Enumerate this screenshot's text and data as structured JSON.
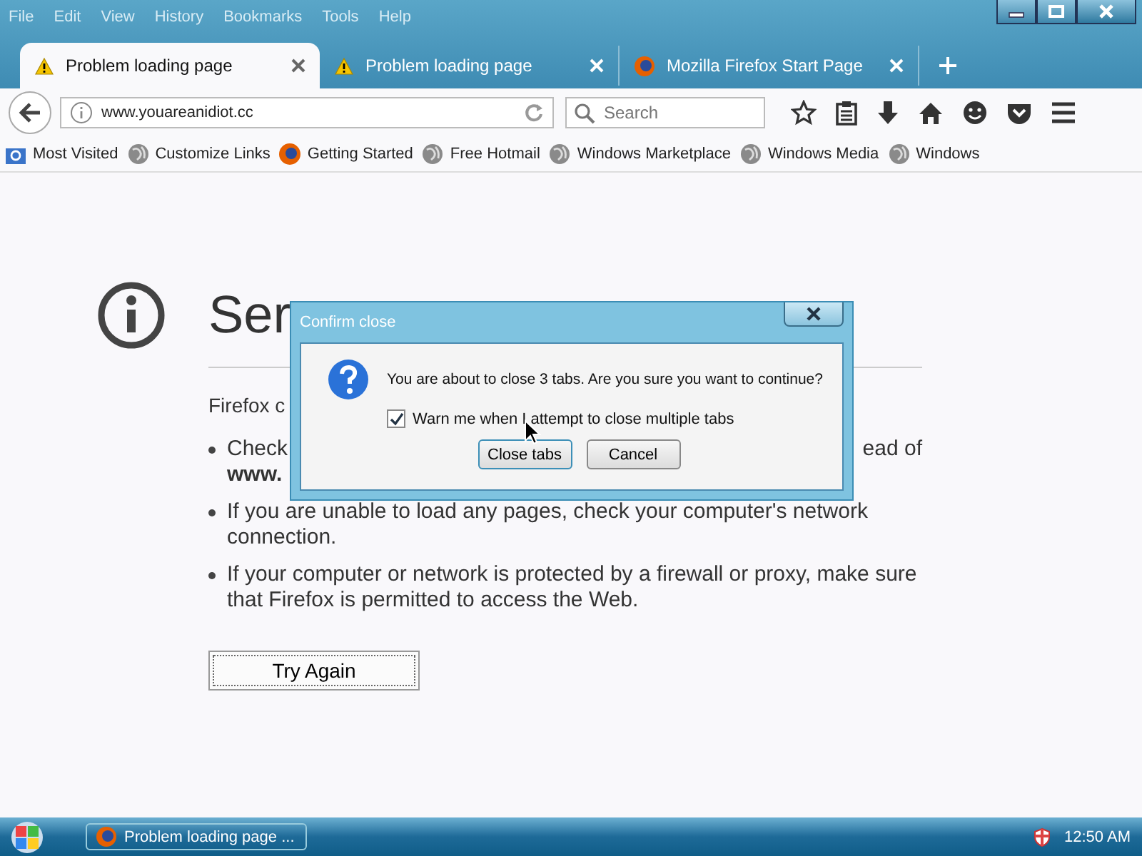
{
  "menu": [
    "File",
    "Edit",
    "View",
    "History",
    "Bookmarks",
    "Tools",
    "Help"
  ],
  "tabs": [
    {
      "title": "Problem loading page",
      "selected": true
    },
    {
      "title": "Problem loading page",
      "selected": false
    },
    {
      "title": "Mozilla Firefox Start Page",
      "selected": false
    }
  ],
  "address": {
    "value": "www.youareanidiot.cc"
  },
  "search": {
    "placeholder": "Search"
  },
  "bookmarks": [
    "Most Visited",
    "Customize Links",
    "Getting Started",
    "Free Hotmail",
    "Windows Marketplace",
    "Windows Media",
    "Windows"
  ],
  "error_page": {
    "heading": "Ser",
    "intro": "Firefox c",
    "bullets": [
      {
        "left": "Check",
        "right": "ead of",
        "line2": "www."
      },
      {
        "left": "If you are unable to load any pages, check your computer's network connection."
      },
      {
        "left": "If your computer or network is protected by a firewall or proxy, make sure that Firefox is permitted to access the Web."
      }
    ],
    "button": "Try Again"
  },
  "dialog": {
    "title": "Confirm close",
    "message": "You are about to close 3 tabs. Are you sure you want to continue?",
    "checkbox": {
      "label": "Warn me when I attempt to close multiple tabs",
      "checked": true
    },
    "buttons": [
      "Close tabs",
      "Cancel"
    ]
  },
  "taskbar": {
    "task": "Problem loading page ...",
    "clock": "12:50 AM"
  }
}
